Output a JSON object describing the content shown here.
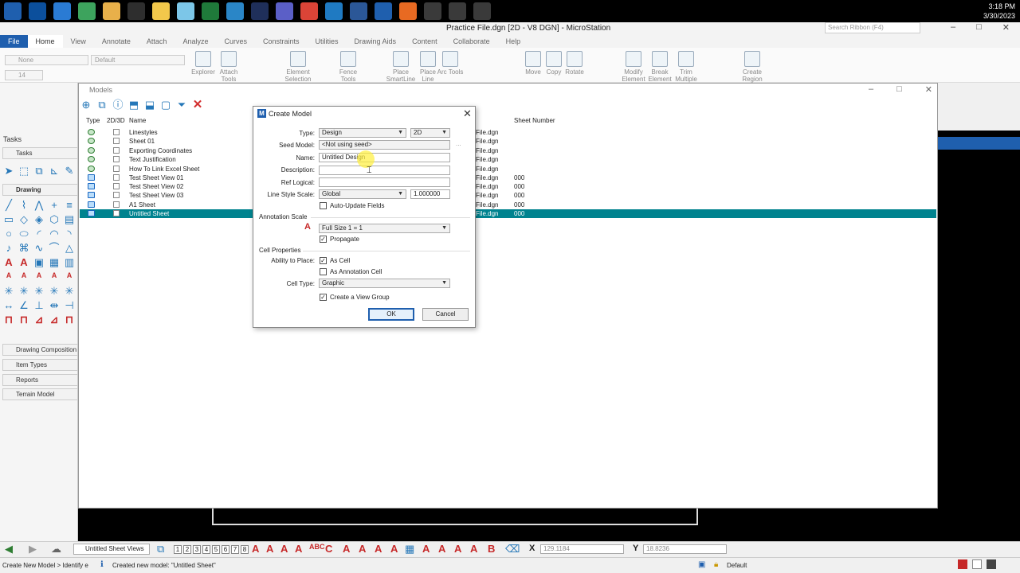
{
  "taskbar": {
    "clock_time": "3:18 PM",
    "clock_date": "3/30/2023",
    "apps": [
      "start-icon",
      "search-icon",
      "task-view-icon",
      "store-icon",
      "outlook-icon",
      "edge-icon",
      "chrome-icon",
      "video-icon",
      "remote-icon",
      "folder-icon",
      "notes-icon",
      "excel-icon",
      "sync-icon",
      "moon-icon",
      "teams-icon",
      "chrome2-icon",
      "refresh-icon",
      "word-icon",
      "microstation-icon",
      "app-orange-icon"
    ],
    "app_colors": [
      "#1f5fae",
      "#0b4f9c",
      "#2a7bd4",
      "#3da35d",
      "#e8b04a",
      "#2e2e2e",
      "#f2c84b",
      "#7cc6e8",
      "#1f7a3a",
      "#2a86c7",
      "#1f2f5a",
      "#5b5fc7",
      "#db4437",
      "#1f7ac2",
      "#2b5797",
      "#1f5fae",
      "#e86a22",
      "#3a3a3a",
      "#3a3a3a",
      "#3a3a3a"
    ]
  },
  "app": {
    "title": "Practice File.dgn [2D - V8 DGN] - MicroStation",
    "search_placeholder": "Search Ribbon (F4)",
    "file_label": "File",
    "menu": [
      "Home",
      "View",
      "Annotate",
      "Attach",
      "Analyze",
      "Curves",
      "Constraints",
      "Utilities",
      "Drawing Aids",
      "Content",
      "Collaborate",
      "Help"
    ]
  },
  "ribbon": {
    "level_combo": "None",
    "style_combo": "Default",
    "weight_value": "14",
    "buttons": [
      "Explorer",
      "Attach Tools",
      "Element Selection",
      "Fence Tools",
      "Place SmartLine",
      "Place Line",
      "Arc Tools",
      "Move",
      "Copy",
      "Rotate",
      "Modify Element",
      "Break Element",
      "Trim Multiple",
      "Create Region"
    ]
  },
  "left_panel": {
    "tasks_header": "Tasks",
    "tasks_combo": "Tasks",
    "drawing_section": "Drawing",
    "sections": [
      "Drawing Composition",
      "Item Types",
      "Reports",
      "Terrain Model"
    ]
  },
  "models": {
    "title": "Models",
    "columns": {
      "type": "Type",
      "dim": "2D/3D",
      "name": "Name",
      "sheet_number": "Sheet Number"
    },
    "rows": [
      {
        "name": "Linestyles",
        "file": "File.dgn",
        "sheet": "",
        "kind": "design"
      },
      {
        "name": "Sheet 01",
        "file": "File.dgn",
        "sheet": "",
        "kind": "design"
      },
      {
        "name": "Exporting Coordinates",
        "file": "File.dgn",
        "sheet": "",
        "kind": "design"
      },
      {
        "name": "Text Justification",
        "file": "File.dgn",
        "sheet": "",
        "kind": "design"
      },
      {
        "name": "How To Link Excel Sheet",
        "file": "File.dgn",
        "sheet": "",
        "kind": "design"
      },
      {
        "name": "Test Sheet View 01",
        "file": "File.dgn",
        "sheet": "000",
        "kind": "sheet"
      },
      {
        "name": "Test Sheet View 02",
        "file": "File.dgn",
        "sheet": "000",
        "kind": "sheet"
      },
      {
        "name": "Test Sheet View 03",
        "file": "File.dgn",
        "sheet": "000",
        "kind": "sheet"
      },
      {
        "name": "A1 Sheet",
        "file": "File.dgn",
        "sheet": "000",
        "kind": "sheet"
      },
      {
        "name": "Untitled Sheet",
        "file": "File.dgn",
        "sheet": "000",
        "kind": "sheet",
        "selected": true
      }
    ]
  },
  "dialog": {
    "title": "Create Model",
    "type_label": "Type:",
    "type_value": "Design",
    "dim_value": "2D",
    "seed_label": "Seed Model:",
    "seed_value": "<Not using seed>",
    "seed_browse": "...",
    "name_label": "Name:",
    "name_value": "Untitled Design",
    "description_label": "Description:",
    "description_value": "",
    "ref_label": "Ref Logical:",
    "ref_value": "",
    "linestyle_label": "Line Style Scale:",
    "linestyle_value": "Global",
    "linestyle_scale": "1.000000",
    "auto_update_label": "Auto-Update Fields",
    "auto_update_checked": false,
    "annotation_group": "Annotation Scale",
    "annotation_value": "Full Size 1 = 1",
    "propagate_label": "Propagate",
    "propagate_checked": true,
    "cell_group": "Cell Properties",
    "ability_label": "Ability to Place:",
    "as_cell_label": "As Cell",
    "as_cell_checked": true,
    "as_annotation_label": "As Annotation Cell",
    "as_annotation_checked": false,
    "cell_type_label": "Cell Type:",
    "cell_type_value": "Graphic",
    "view_group_label": "Create a View Group",
    "view_group_checked": true,
    "ok_label": "OK",
    "cancel_label": "Cancel"
  },
  "bottom_toolbar": {
    "views_combo": "Untitled Sheet Views",
    "view_numbers": [
      "1",
      "2",
      "3",
      "4",
      "5",
      "6",
      "7",
      "8"
    ],
    "x_label": "X",
    "x_value": "129.1184",
    "y_label": "Y",
    "y_value": "18.8236"
  },
  "status": {
    "prompt": "Create New Model > Identify e",
    "message": "Created new model: \"Untitled Sheet\"",
    "level": "Default"
  }
}
